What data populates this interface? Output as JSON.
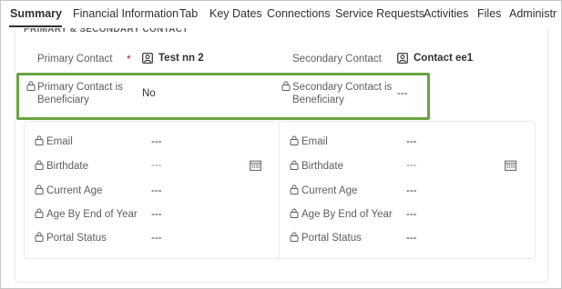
{
  "tabs": [
    {
      "label": "Summary",
      "active": true
    },
    {
      "label": "Financial Information",
      "active": false
    },
    {
      "label": "Tab",
      "active": false
    },
    {
      "label": "Key Dates",
      "active": false
    },
    {
      "label": "Connections",
      "active": false
    },
    {
      "label": "Service Requests",
      "active": false
    },
    {
      "label": "Activities",
      "active": false
    },
    {
      "label": "Files",
      "active": false
    },
    {
      "label": "Administr",
      "active": false
    }
  ],
  "section": {
    "title": "PRIMARY & SECONDARY CONTACT",
    "primary_contact": {
      "label": "Primary Contact",
      "required_mark": "*",
      "value": "Test nn 2",
      "icon": "contact-card-icon"
    },
    "secondary_contact": {
      "label": "Secondary Contact",
      "value": "Contact ee1",
      "icon": "contact-card-icon"
    },
    "primary_beneficiary": {
      "label_line1": "Primary Contact is",
      "label_line2": "Beneficiary",
      "value": "No"
    },
    "secondary_beneficiary": {
      "label_line1": "Secondary Contact is",
      "label_line2": "Beneficiary",
      "value": "---"
    }
  },
  "left_panel": {
    "email": {
      "label": "Email",
      "value": "---"
    },
    "birthdate": {
      "label": "Birthdate",
      "value": "---"
    },
    "current_age": {
      "label": "Current Age",
      "value": "---"
    },
    "age_by_end_of_year": {
      "label": "Age By End of Year",
      "value": "---"
    },
    "portal_status": {
      "label": "Portal Status",
      "value": "---"
    }
  },
  "right_panel": {
    "email": {
      "label": "Email",
      "value": "---"
    },
    "birthdate": {
      "label": "Birthdate",
      "value": "---"
    },
    "current_age": {
      "label": "Current Age",
      "value": "---"
    },
    "age_by_end_of_year": {
      "label": "Age By End of Year",
      "value": "---"
    },
    "portal_status": {
      "label": "Portal Status",
      "value": "---"
    }
  },
  "colors": {
    "highlight": "#6aa341",
    "required": "#a4262c",
    "label": "#605e5c",
    "text": "#323130"
  }
}
